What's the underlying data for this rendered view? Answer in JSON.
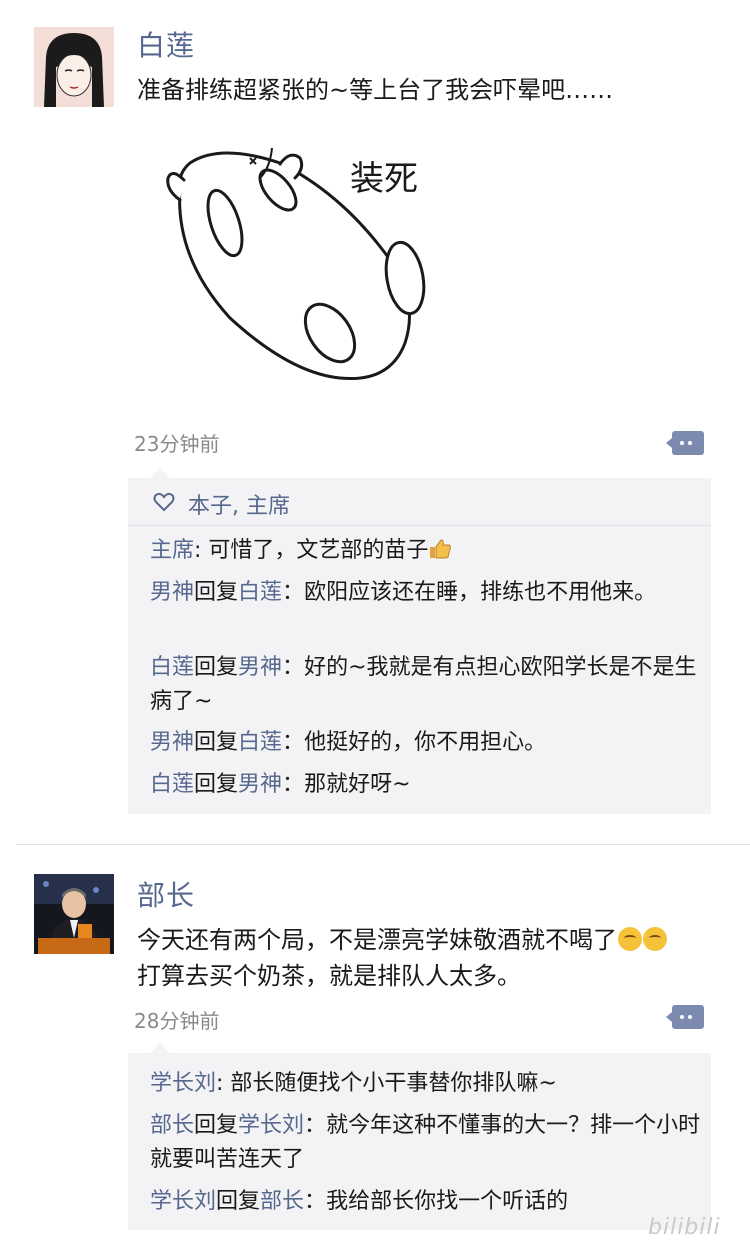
{
  "posts": [
    {
      "username": "白莲",
      "text": "准备排练超紧张的~等上台了我会吓晕吧……",
      "sticker_text": "装死",
      "time": "23分钟前",
      "likes": "本子, 主席",
      "comments": [
        {
          "from": "主席",
          "to": "",
          "text": "可惜了，文艺部的苗子"
        },
        {
          "from": "男神",
          "reply_word": "回复",
          "to": "白莲",
          "text": "欧阳应该还在睡，排练也不用他来。"
        },
        {
          "from": "白莲",
          "reply_word": "回复",
          "to": "男神",
          "text": "好的~我就是有点担心欧阳学长是不是生病了~"
        },
        {
          "from": "男神",
          "reply_word": "回复",
          "to": "白莲",
          "text": "他挺好的，你不用担心。"
        },
        {
          "from": "白莲",
          "reply_word": "回复",
          "to": "男神",
          "text": "那就好呀~"
        }
      ]
    },
    {
      "username": "部长",
      "text_line1": "今天还有两个局，不是漂亮学妹敬酒就不喝了",
      "text_line2": "打算去买个奶茶，就是排队人太多。",
      "time": "28分钟前",
      "comments": [
        {
          "from": "学长刘",
          "to": "",
          "text": "部长随便找个小干事替你排队嘛~"
        },
        {
          "from": "部长",
          "reply_word": "回复",
          "to": "学长刘",
          "text": "就今年这种不懂事的大一？排一个小时就要叫苦连天了"
        },
        {
          "from": "学长刘",
          "reply_word": "回复",
          "to": "部长",
          "text": "我给部长你找一个听话的"
        }
      ]
    }
  ],
  "watermark": "bilibili",
  "colors": {
    "name": "#57688f",
    "comment_bg": "#f3f3f5",
    "time": "#8a8a8a",
    "more_btn": "#7d8ab0"
  }
}
